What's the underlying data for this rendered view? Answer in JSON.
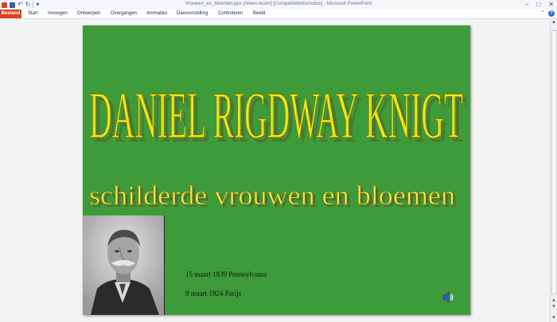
{
  "window": {
    "title": "Vrouwen_en_bloemen.pps [Alleen-lezen] [Compatibiliteitsmodus] - Microsoft PowerPoint",
    "controls": [
      "–",
      "□",
      "✕"
    ]
  },
  "ribbon": {
    "tabs": [
      "Bestand",
      "Start",
      "Invoegen",
      "Ontwerpen",
      "Overgangen",
      "Animaties",
      "Diavoorstelling",
      "Controleren",
      "Beeld"
    ],
    "help_label": "?"
  },
  "slide": {
    "background": "#3d9b39",
    "title": "DANIEL RIGDWAY KNIGT",
    "subtitle": "schilderde vrouwen en bloemen",
    "title_fill": "#f6f21c",
    "date_birth": "15 maart 1839 Pennsylvania",
    "date_death": "9 maart 1924 Parijs"
  },
  "icons": {
    "app": "powerpoint-icon",
    "save": "save-icon",
    "undo": "undo-icon",
    "redo": "redo-icon",
    "sound": "speaker-icon"
  }
}
